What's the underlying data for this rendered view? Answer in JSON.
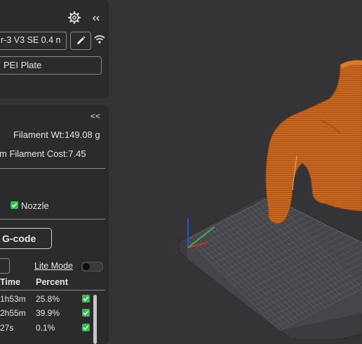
{
  "printer": {
    "name": "r-3 V3 SE 0.4 n",
    "plate": "PEI Plate"
  },
  "icons": {
    "settings": "gear-icon",
    "collapse": "chevron-double-left-icon",
    "edit": "pencil-icon",
    "wifi": "wifi-icon"
  },
  "slice_info": {
    "collapse_label": "<<",
    "filament_weight": "Filament Wt:149.08 g",
    "filament_cost": "m  Filament Cost:7.45",
    "nozzle_label": "Nozzle",
    "export_button": "G-code",
    "lite_mode_label": "Lite Mode",
    "table": {
      "headers": [
        "Time",
        "Percent"
      ],
      "rows": [
        {
          "time": "1h53m",
          "percent": "25.8%"
        },
        {
          "time": "2h55m",
          "percent": "39.9%"
        },
        {
          "time": "27s",
          "percent": "0.1%"
        }
      ]
    }
  },
  "colors": {
    "accent": "#2fc24a",
    "model": "#c8691f",
    "bed": "#45454a"
  }
}
